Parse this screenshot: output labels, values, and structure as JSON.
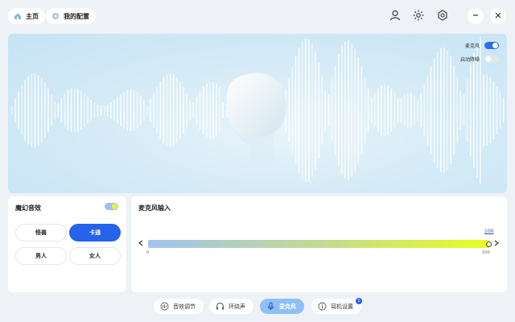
{
  "nav": {
    "home": {
      "label": "主页",
      "icon": "home-icon"
    },
    "config": {
      "label": "我的配置",
      "icon": "settings-group-icon"
    }
  },
  "window": {
    "icons": [
      "user-icon",
      "brightness-icon",
      "gear-icon",
      "minimize-icon",
      "close-icon"
    ]
  },
  "hero": {
    "mic_toggle": {
      "label": "麦克风",
      "on": true
    },
    "noise_toggle": {
      "label": "启动降噪",
      "on": false
    },
    "accent": "#2f6fe6"
  },
  "voice_panel": {
    "title": "魔幻音效",
    "enabled": true,
    "options": [
      {
        "label": "怪兽",
        "active": false
      },
      {
        "label": "卡通",
        "active": true
      },
      {
        "label": "男人",
        "active": false
      },
      {
        "label": "女人",
        "active": false
      }
    ]
  },
  "mic_panel": {
    "title": "麦克风输入",
    "value_label": "100",
    "min_label": "0",
    "max_label": "100",
    "level": 1.0
  },
  "bottom_tabs": [
    {
      "label": "音效调节",
      "icon": "equalizer-icon",
      "active": false
    },
    {
      "label": "环绕声",
      "icon": "headphones-icon",
      "active": false
    },
    {
      "label": "麦克风",
      "icon": "microphone-icon",
      "active": true
    },
    {
      "label": "耳机设置",
      "icon": "info-icon",
      "active": false,
      "badge": "1"
    }
  ]
}
